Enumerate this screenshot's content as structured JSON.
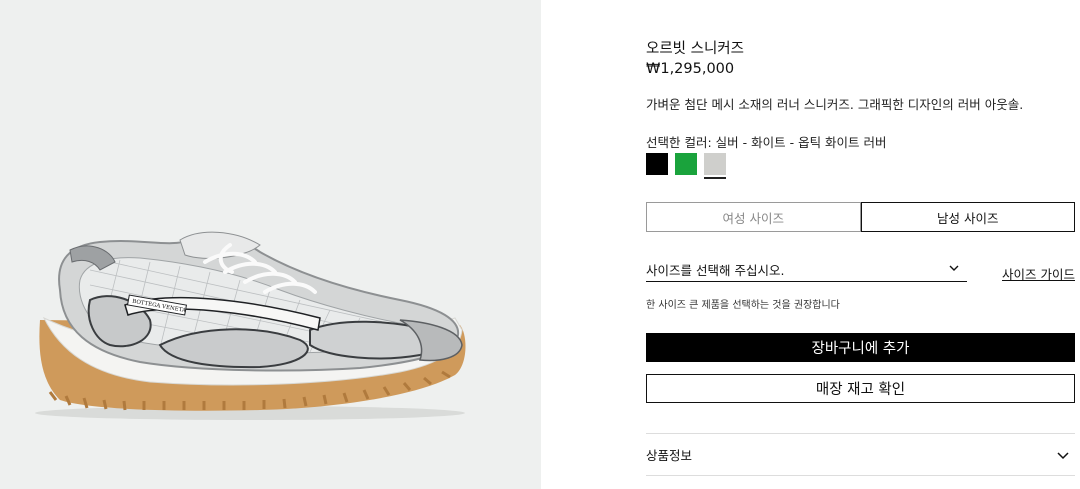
{
  "product": {
    "image_alt": "product-sneaker-image",
    "brand_on_shoe": "BOTTEGA VENETA",
    "title": "오르빗 스니커즈",
    "price": "₩1,295,000",
    "description": "가벼운 첨단 메시 소재의 러너 스니커즈. 그래픽한 디자인의 러버 아웃솔."
  },
  "color": {
    "label": "선택한 컬러: 실버 - 화이트 - 옵틱 화이트 러버",
    "swatches": [
      {
        "name": "black",
        "hex": "#000000"
      },
      {
        "name": "green",
        "hex": "#1aa33c"
      },
      {
        "name": "silver",
        "hex": "#cfcfcc",
        "selected": true
      }
    ]
  },
  "size_tabs": {
    "women": "여성 사이즈",
    "men": "남성 사이즈",
    "active": "men"
  },
  "size_select": {
    "placeholder": "사이즈를 선택해 주십시오."
  },
  "size_guide": "사이즈 가이드",
  "size_note": "한 사이즈 큰 제품을 선택하는 것을 권장합니다",
  "buttons": {
    "add_to_cart": "장바구니에 추가",
    "check_stock": "매장 재고 확인"
  },
  "accordion": {
    "product_info": "상품정보"
  },
  "colors": {
    "image_bg": "#eef0ef",
    "primary_button": "#000000",
    "divider": "#dddddd"
  }
}
